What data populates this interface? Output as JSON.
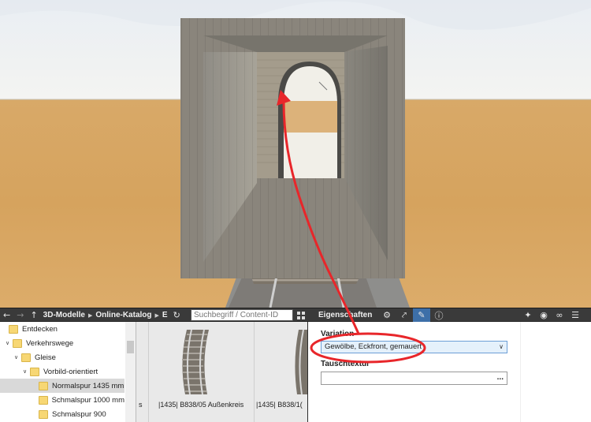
{
  "toolbar": {
    "back_icon": "arrow-left-icon",
    "forward_icon": "arrow-right-icon",
    "up_icon": "arrow-up-icon",
    "breadcrumb": [
      "3D-Modelle",
      "Online-Katalog",
      "E"
    ],
    "refresh_icon": "refresh-icon",
    "search_placeholder": "Suchbegriff / Content-ID",
    "grid_icon": "grid-view-icon",
    "properties_title": "Eigenschaften",
    "tool_icons": [
      "gear-icon",
      "axes-icon",
      "brush-icon",
      "info-icon"
    ],
    "right_icons": [
      "pin-icon",
      "eye-icon",
      "link-icon",
      "menu-icon"
    ]
  },
  "tree": {
    "items": [
      {
        "label": "Entdecken",
        "chevron": "",
        "selected": false
      },
      {
        "label": "Verkehrswege",
        "chevron": "∨",
        "selected": false
      },
      {
        "label": "Gleise",
        "chevron": "∨",
        "selected": false
      },
      {
        "label": "Vorbild-orientiert",
        "chevron": "∨",
        "selected": false
      },
      {
        "label": "Normalspur  1435 mm",
        "chevron": "",
        "selected": true
      },
      {
        "label": "Schmalspur  1000 mm",
        "chevron": "",
        "selected": false
      },
      {
        "label": "Schmalspur  900",
        "chevron": "",
        "selected": false
      }
    ]
  },
  "catalog": {
    "tiles": [
      {
        "label": "s"
      },
      {
        "label": "|1435| B838/05 Außenkreis"
      },
      {
        "label": "|1435| B838/1("
      }
    ]
  },
  "properties": {
    "variation_label": "Variation",
    "variation_value": "Gewölbe, Eckfront, gemauert",
    "texture_label": "Tauschtextur",
    "texture_value": "",
    "browse_label": "..."
  },
  "colors": {
    "annotation": "#e8262a",
    "active_tool": "#3d6fa8",
    "toolbar_bg": "#3a3a3a"
  }
}
